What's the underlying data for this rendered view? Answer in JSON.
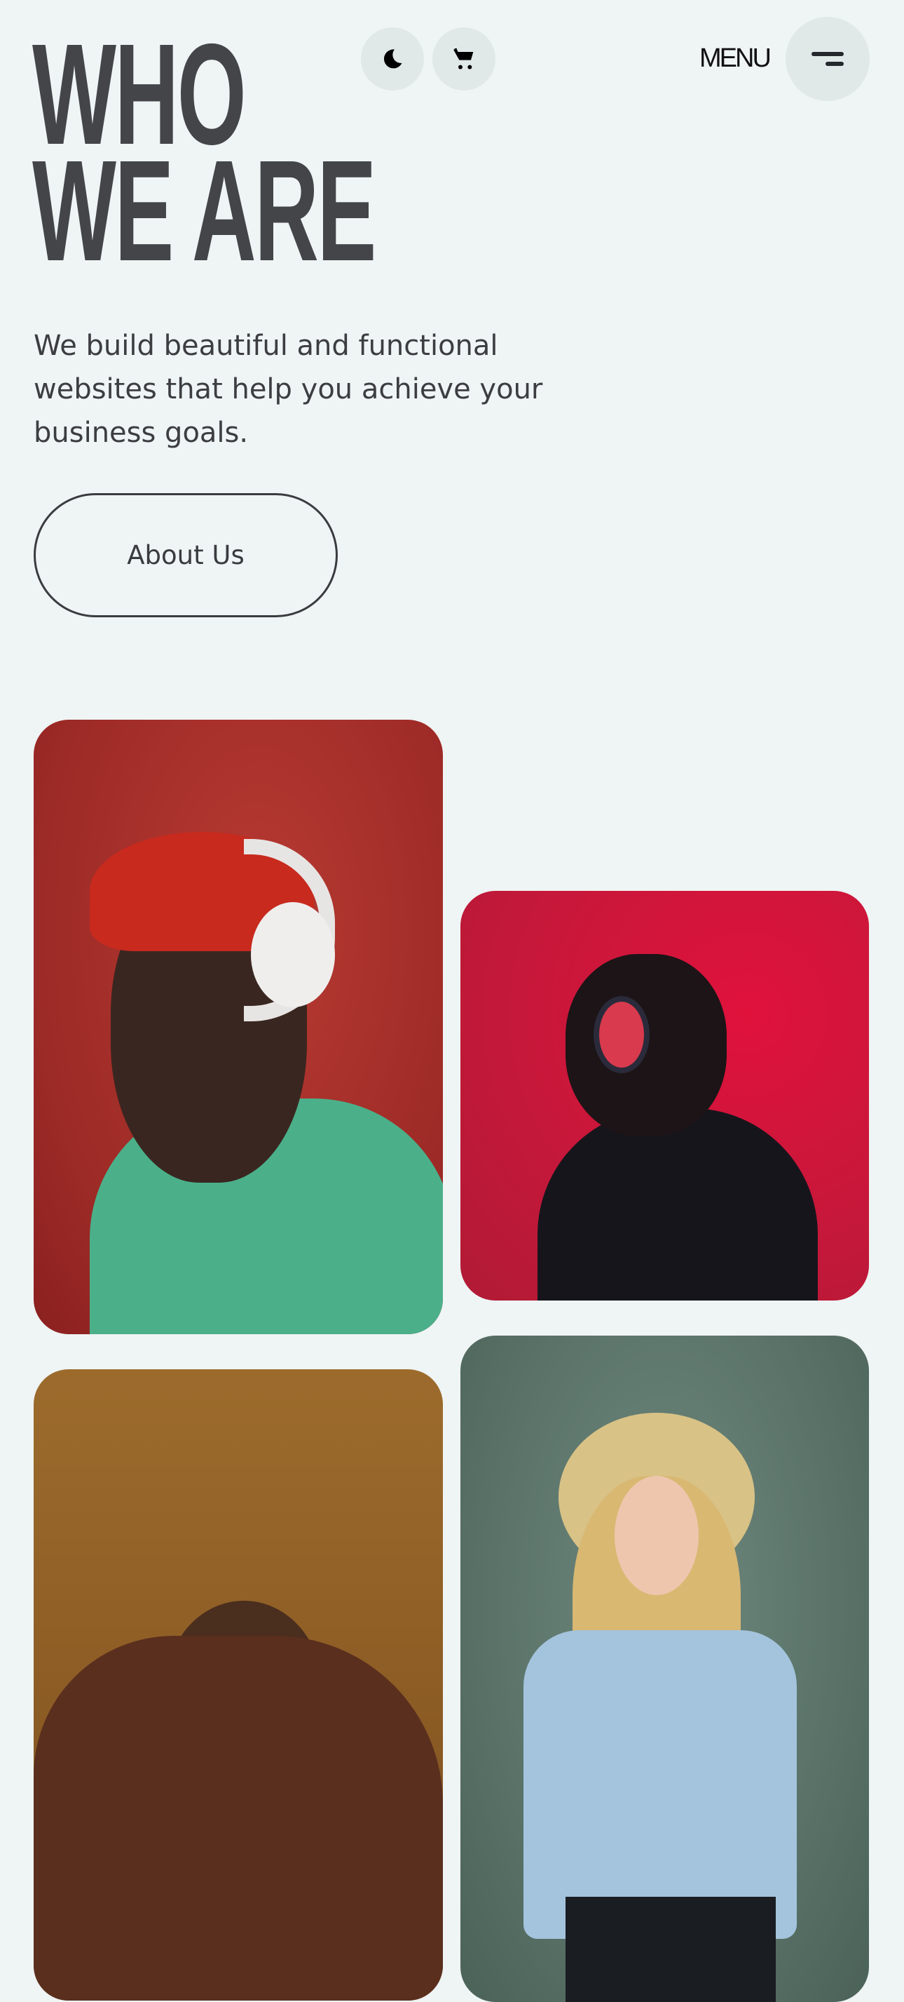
{
  "header": {
    "menu_label": "MENU",
    "icons": [
      "moon-icon",
      "cart-icon",
      "hamburger-icon"
    ]
  },
  "hero": {
    "title_line1": "WHO",
    "title_line2": "WE ARE",
    "description": "We build beautiful and functional websites that help you achieve your business goals.",
    "button_label": "About Us"
  },
  "gallery": {
    "colors": {
      "photo1": "#a8302b",
      "photo2": "#d0163d",
      "photo3": "#8c5c25",
      "photo4": "#5d756b"
    }
  }
}
